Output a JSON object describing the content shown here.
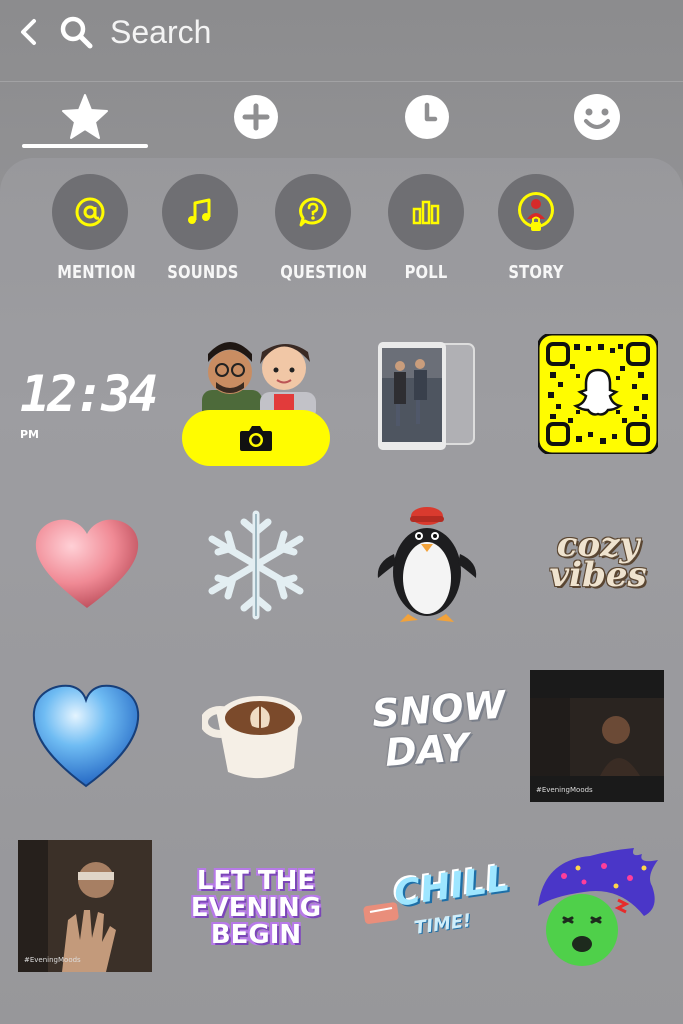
{
  "header": {
    "search_label": "Search"
  },
  "tabs": [
    {
      "icon": "star-icon",
      "selected": true
    },
    {
      "icon": "add-circle-icon",
      "selected": false
    },
    {
      "icon": "clock-icon",
      "selected": false
    },
    {
      "icon": "smiley-icon",
      "selected": false
    }
  ],
  "tools": [
    {
      "label": "MENTION",
      "icon": "at-sign-icon"
    },
    {
      "label": "SOUNDS",
      "icon": "music-note-icon"
    },
    {
      "label": "QUESTION",
      "icon": "question-bubble-icon"
    },
    {
      "label": "POLL",
      "icon": "poll-bars-icon"
    },
    {
      "label": "STORY",
      "icon": "story-ring-icon"
    }
  ],
  "stickers": {
    "clock": {
      "time": "12:34",
      "suffix": "PM"
    },
    "cozy": {
      "line1": "cozy",
      "line2": "vibes"
    },
    "snow": {
      "line1": "SNOW",
      "line2": "DAY"
    },
    "evening": {
      "line1": "LET THE",
      "line2": "EVENING",
      "line3": "BEGIN"
    },
    "chill": {
      "line1": "CHILL",
      "line2": "TIME!"
    },
    "gif1_caption": "#EveningMoods",
    "gif2_caption": "#EveningMoods"
  },
  "colors": {
    "accent": "#fffc00",
    "tool_bg": "#6f6f73"
  }
}
